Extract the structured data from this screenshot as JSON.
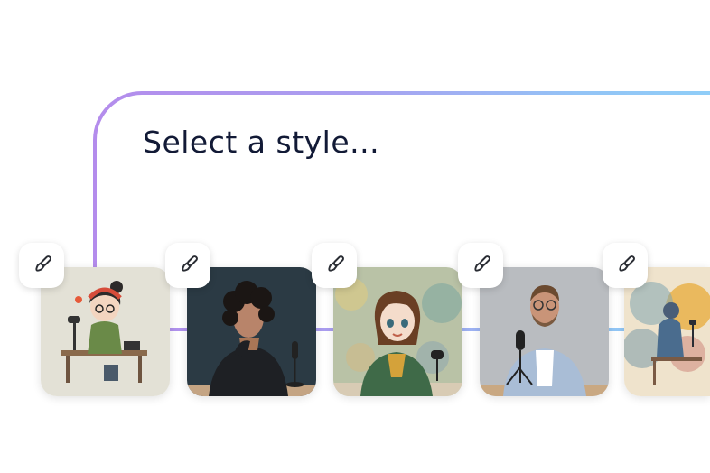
{
  "prompt": {
    "text": "Select a style..."
  },
  "styles": [
    {
      "icon": "paintbrush-icon",
      "art": "cartoon podcaster with headphones at desk",
      "accent": "#e65a3a"
    },
    {
      "icon": "paintbrush-icon",
      "art": "photo of woman with curly hair and microphone",
      "accent": "#2b3a44"
    },
    {
      "icon": "paintbrush-icon",
      "art": "anime girl with microphone on watercolor backdrop",
      "accent": "#3f6a48"
    },
    {
      "icon": "paintbrush-icon",
      "art": "photo of man in suit with podcast microphone",
      "accent": "#b8c8da"
    },
    {
      "icon": "paintbrush-icon",
      "art": "watercolor painting of person at microphone",
      "accent": "#e9b24a"
    }
  ],
  "colors": {
    "border_start": "#b48cec",
    "border_end": "#8fd0f8",
    "prompt_text": "#121a36"
  }
}
